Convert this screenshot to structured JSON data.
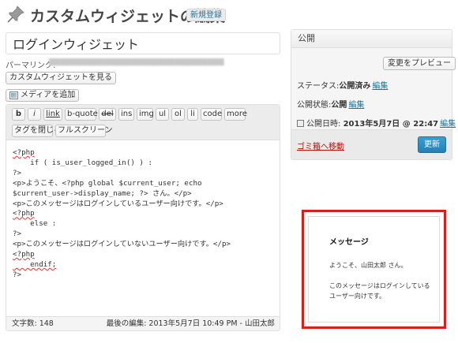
{
  "header": {
    "title": "カスタムウィジェットの編集",
    "new_button": "新規登録",
    "icon": "pushpin-icon"
  },
  "post": {
    "title": "ログインウィジェット",
    "permalink_label": "パーマリンク:",
    "view_button": "カスタムウィジェットを見る",
    "add_media_button": "メディアを追加"
  },
  "toolbar": {
    "buttons": [
      "b",
      "i",
      "link",
      "b-quote",
      "del",
      "ins",
      "img",
      "ul",
      "ol",
      "li",
      "code",
      "more"
    ],
    "close_tags": "タグを閉じる",
    "fullscreen": "フルスクリーン"
  },
  "editor": {
    "lines": [
      "<?php",
      "    if ( is_user_logged_in() ) :",
      "?>",
      "<p>ようこそ、<?php global $current_user; echo",
      "$current_user->display_name; ?> さん。</p>",
      "<p>このメッセージはログインしているユーザー向けです。</p>",
      "<?php",
      "    else :",
      "?>",
      "<p>このメッセージはログインしていないユーザー向けです。</p>",
      "<?php",
      "    endif;",
      "?>"
    ],
    "word_count": "文字数: 148",
    "last_edited": "最後の編集: 2013年5月7日 10:49 PM - 山田太郎"
  },
  "publish": {
    "heading": "公開",
    "preview_button": "変更をプレビュー",
    "status_label": "ステータス:",
    "status_value": "公開済み",
    "visibility_label": "公開状態:",
    "visibility_value": "公開",
    "date_label": "公開日時:",
    "date_value": "2013年5月7日 @ 22:47",
    "edit_link": "編集",
    "trash_link": "ゴミ箱へ移動",
    "update_button": "更新"
  },
  "preview_widget": {
    "title": "メッセージ",
    "greeting": "ようこそ、山田太郎 さん。",
    "message_line1": "このメッセージはログインしている",
    "message_line2": "ユーザー向けです。"
  },
  "colors": {
    "link": "#21759b",
    "primary_button": "#2380b8",
    "callout_border": "#e11a1a",
    "trash": "#bc0b0b"
  }
}
